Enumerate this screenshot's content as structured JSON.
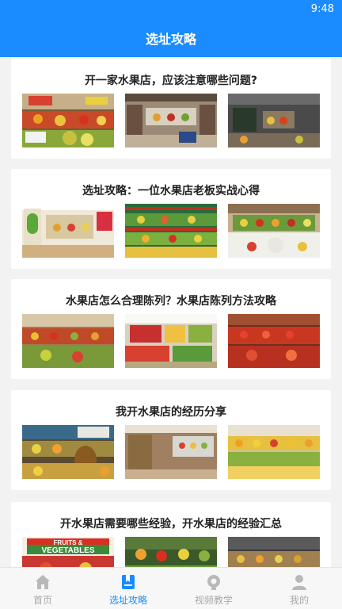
{
  "status": {
    "time": "9:48"
  },
  "header": {
    "title": "选址攻略"
  },
  "articles": [
    {
      "title": "开一家水果店，应该注意哪些问题?"
    },
    {
      "title": "选址攻略：一位水果店老板实战心得"
    },
    {
      "title": "水果店怎么合理陈列？水果店陈列方法攻略"
    },
    {
      "title": "我开水果店的经历分享"
    },
    {
      "title": "开水果店需要哪些经验，开水果店的经验汇总"
    }
  ],
  "signage": {
    "text1": "FRUITS &",
    "text2": "VEGETABLES"
  },
  "tabbar": {
    "tabs": [
      {
        "label": "首页",
        "icon": "home-icon"
      },
      {
        "label": "选址攻略",
        "icon": "bookmark-icon"
      },
      {
        "label": "视频教学",
        "icon": "play-icon"
      },
      {
        "label": "我的",
        "icon": "user-icon"
      }
    ]
  },
  "colors": {
    "primary": "#1a8cff",
    "inactive": "#a9a9a9"
  }
}
